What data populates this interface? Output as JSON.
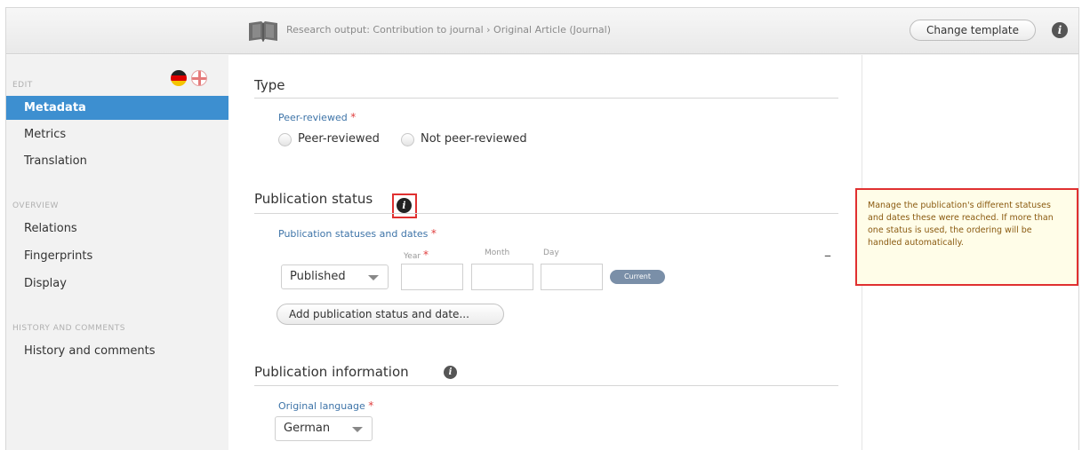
{
  "header": {
    "breadcrumb_root": "Research output: Contribution to journal",
    "breadcrumb_sep": "›",
    "breadcrumb_leaf": "Original Article (Journal)",
    "change_template_label": "Change template",
    "icons": {
      "book": "book-icon",
      "info": "info-icon"
    }
  },
  "sidebar": {
    "sections": [
      {
        "heading": "EDIT",
        "items": [
          "Metadata",
          "Metrics",
          "Translation"
        ]
      },
      {
        "heading": "OVERVIEW",
        "items": [
          "Relations",
          "Fingerprints",
          "Display"
        ]
      },
      {
        "heading": "HISTORY AND COMMENTS",
        "items": [
          "History and comments"
        ]
      }
    ],
    "active_item": "Metadata",
    "flags": [
      "german-flag-icon",
      "english-flag-icon"
    ],
    "accent_color": "#3d8fd0"
  },
  "main": {
    "type": {
      "title": "Type",
      "peer_label": "Peer-reviewed",
      "required_mark": "*",
      "options": [
        "Peer-reviewed",
        "Not peer-reviewed"
      ]
    },
    "publication_status": {
      "title": "Publication status",
      "field_label": "Publication statuses and dates",
      "status_value": "Published",
      "date_labels": {
        "year": "Year",
        "month": "Month",
        "day": "Day"
      },
      "current_badge": "Current",
      "remove_symbol": "–",
      "add_button": "Add publication status and date..."
    },
    "publication_information": {
      "title": "Publication information",
      "language_label": "Original language",
      "language_value": "German"
    }
  },
  "tooltip": {
    "text": "Manage the publication's different statuses and dates these were reached. If more than one status is used, the ordering will be handled automatically."
  },
  "colors": {
    "highlight": "#e03030",
    "label_blue": "#3e74a8",
    "required_red": "#e04040"
  }
}
